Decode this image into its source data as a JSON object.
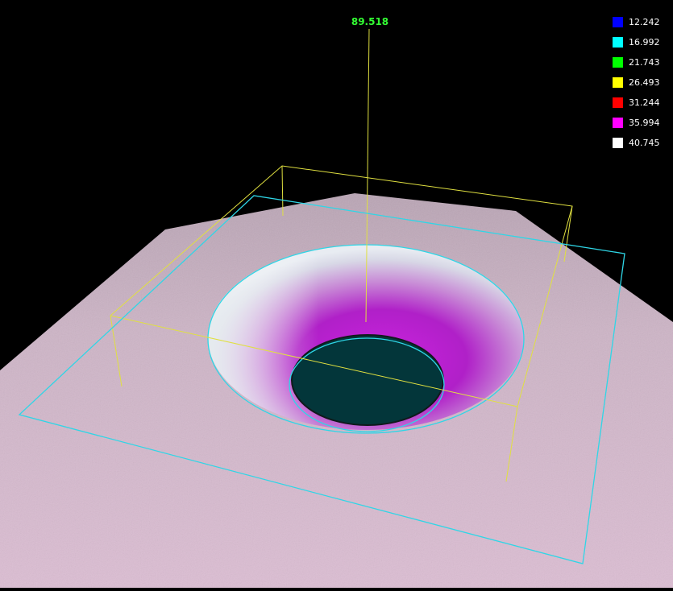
{
  "viewer": {
    "peak_height_label": "89.518",
    "peak_label_color": "#33ff33",
    "surface_color": "#d9b8cf",
    "hole_color": "#03363a",
    "bounding_box_yellow": "#e0e040",
    "bounding_box_cyan": "#2fd6e6"
  },
  "legend": {
    "items": [
      {
        "label": "12.242",
        "color": "#0000ff"
      },
      {
        "label": "16.992",
        "color": "#00ffff"
      },
      {
        "label": "21.743",
        "color": "#00ff00"
      },
      {
        "label": "26.493",
        "color": "#ffff00"
      },
      {
        "label": "31.244",
        "color": "#ff0000"
      },
      {
        "label": "35.994",
        "color": "#ff00ff"
      },
      {
        "label": "40.745",
        "color": "#ffffff"
      }
    ]
  }
}
